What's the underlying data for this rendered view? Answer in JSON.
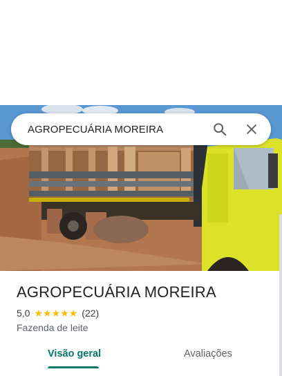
{
  "search": {
    "query": "AGROPECUÁRIA MOREIRA",
    "search_icon": "search-icon",
    "close_icon": "close-icon"
  },
  "place": {
    "title": "AGROPECUÁRIA MOREIRA",
    "rating": "5,0",
    "stars": 5,
    "reviews": "(22)",
    "category": "Fazenda de leite"
  },
  "tabs": [
    {
      "label": "Visão geral",
      "active": true
    },
    {
      "label": "Avaliações",
      "active": false
    }
  ],
  "colors": {
    "accent": "#00796b",
    "star": "#fbbc04"
  }
}
